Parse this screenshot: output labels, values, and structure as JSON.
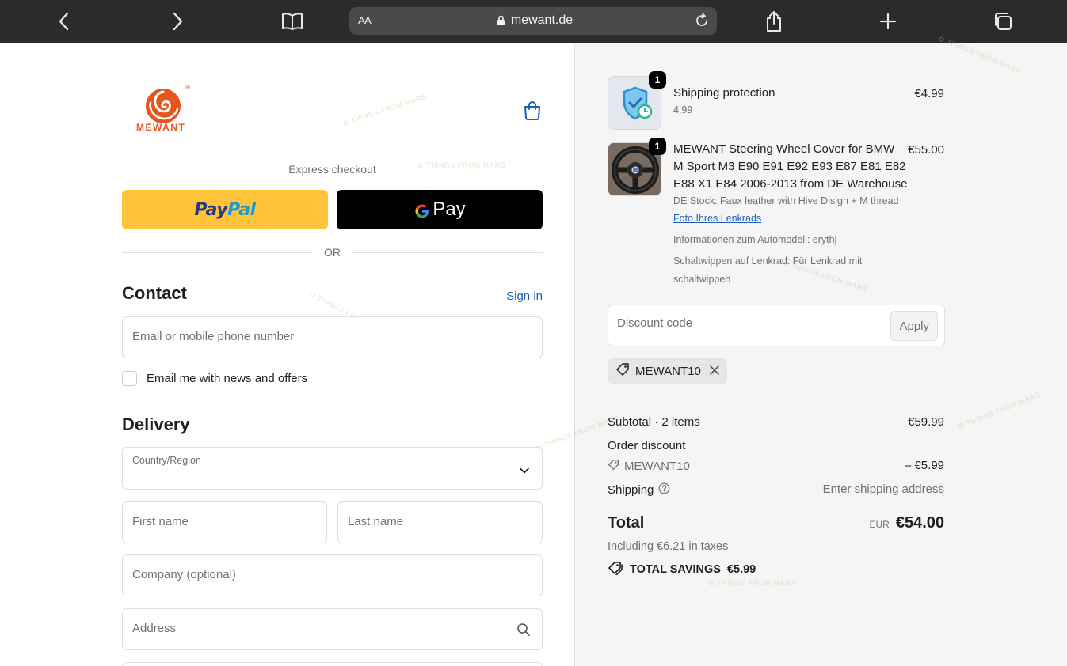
{
  "browser": {
    "text_size_label": "AA",
    "host": "mewant.de",
    "icons": [
      "back-icon",
      "forward-icon",
      "bookmarks-icon",
      "lock-icon",
      "reload-icon",
      "share-icon",
      "new-tab-icon",
      "tabs-icon"
    ]
  },
  "brand": {
    "name": "MEWANT",
    "registered": "®",
    "accent": "#e8541e"
  },
  "checkout": {
    "express_label": "Express checkout",
    "paypal_label_1": "Pay",
    "paypal_label_2": "Pal",
    "gpay_label": "Pay",
    "or_label": "OR",
    "contact": {
      "title": "Contact",
      "sign_in": "Sign in",
      "email_placeholder": "Email or mobile phone number",
      "newsletter_label": "Email me with news and offers"
    },
    "delivery": {
      "title": "Delivery",
      "country_label": "Country/Region",
      "first_name_placeholder": "First name",
      "last_name_placeholder": "Last name",
      "company_placeholder": "Company (optional)",
      "address_placeholder": "Address"
    }
  },
  "summary": {
    "items": [
      {
        "qty": "1",
        "title": "Shipping protection",
        "subtitle": "4.99",
        "price": "€4.99"
      },
      {
        "qty": "1",
        "title_line_1": "MEWANT Steering Wheel Cover for BMW",
        "title_line_2": "M Sport M3 E90 E91 E92 E93 E87 E81 E82",
        "title_line_3": "E88 X1 E84 2006-2013 from DE Warehouse",
        "variant": "DE Stock: Faux leather with Hive Disign + M thread",
        "photo_link": "Foto Ihres Lenkrads",
        "info_1": "Informationen zum Automodell: erythj",
        "info_2_line_1": "Schaltwippen auf Lenkrad: Für Lenkrad mit",
        "info_2_line_2": "schaltwippen",
        "price": "€55.00"
      }
    ],
    "discount_placeholder": "Discount code",
    "apply_label": "Apply",
    "applied_code": "MEWANT10",
    "subtotal_label": "Subtotal · 2 items",
    "subtotal_value": "€59.99",
    "order_discount_label": "Order discount",
    "discount_code": "MEWANT10",
    "discount_value": "– €5.99",
    "shipping_label": "Shipping",
    "shipping_value": "Enter shipping address",
    "total_label": "Total",
    "currency": "EUR",
    "total_value": "€54.00",
    "taxes_note": "Including €6.21 in taxes",
    "savings_label": "TOTAL SAVINGS",
    "savings_value": "€5.99"
  },
  "colors": {
    "paypal_bg": "#ffc439",
    "gpay_bg": "#000000",
    "link": "#1c5fb8",
    "summary_bg": "#f5f5f5"
  }
}
